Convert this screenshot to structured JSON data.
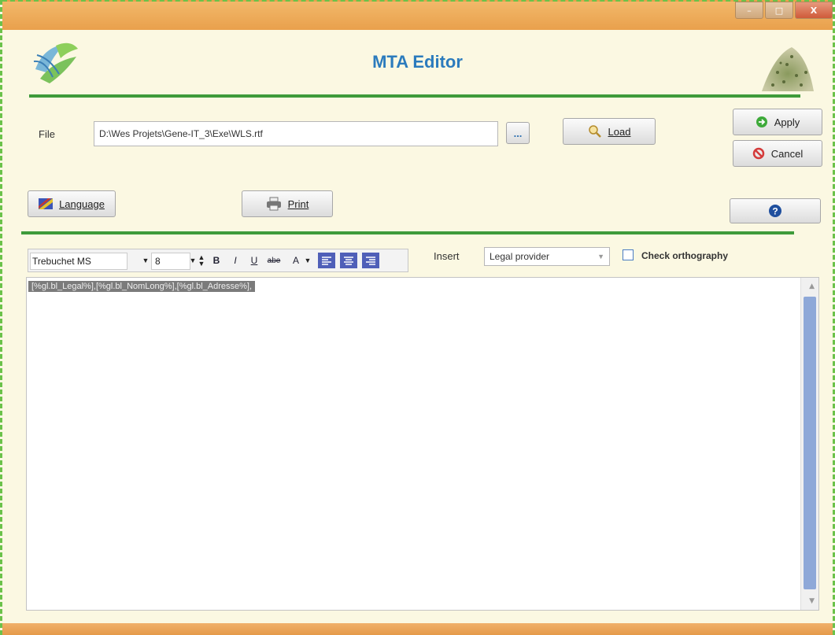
{
  "window": {
    "title": "MTA Editor",
    "controls": {
      "minimize": "–",
      "maximize": "□",
      "close": "X"
    }
  },
  "file": {
    "label": "File",
    "path": "D:\\Wes Projets\\Gene-IT_3\\Exe\\WLS.rtf",
    "browse_label": "...",
    "load_label": "Load"
  },
  "actions": {
    "apply_label": "Apply",
    "cancel_label": "Cancel",
    "language_label": "Language",
    "print_label": "Print",
    "help_label": "?"
  },
  "format_toolbar": {
    "font": "Trebuchet MS",
    "size": "8",
    "bold": "B",
    "italic": "I",
    "underline": "U",
    "strike": "abe",
    "font_color": "A"
  },
  "insert": {
    "label": "Insert",
    "selected": "Legal provider"
  },
  "check_orthography": {
    "label": "Check orthography",
    "checked": false
  },
  "editor": {
    "content": "[%gl.bl_Legal%],[%gl.bl_NomLong%],[%gl.bl_Adresse%],"
  },
  "colors": {
    "title_blue": "#2b7bbd",
    "divider_green": "#3e9b3b",
    "titlebar_orange": "#e9a04c",
    "background": "#fbf8e2"
  }
}
